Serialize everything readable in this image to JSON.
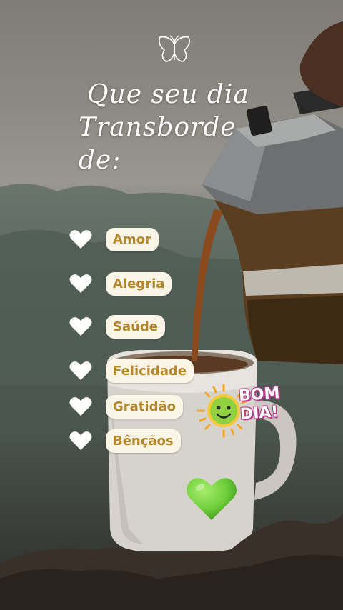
{
  "title": {
    "line1": "Que seu dia",
    "line2": "Transborde de:"
  },
  "items": [
    {
      "label": "Amor"
    },
    {
      "label": "Alegria"
    },
    {
      "label": "Saúde"
    },
    {
      "label": "Felicidade"
    },
    {
      "label": "Gratidão"
    },
    {
      "label": "Bênçãos"
    }
  ],
  "sticker": {
    "line1": "BOM",
    "line2": "DIA!"
  },
  "icons": {
    "top": "butterfly-icon",
    "bullets": "heart-icon",
    "sticker": "sun-icon",
    "bottom": "green-heart-icon"
  },
  "colors": {
    "pill_bg": "#fbf5e8",
    "pill_text": "#b5862a",
    "heart": "#ffffff",
    "sun": "#f6c93a",
    "green_heart": "#6fcf3a",
    "bomdia_outline": "#b53a8a"
  }
}
